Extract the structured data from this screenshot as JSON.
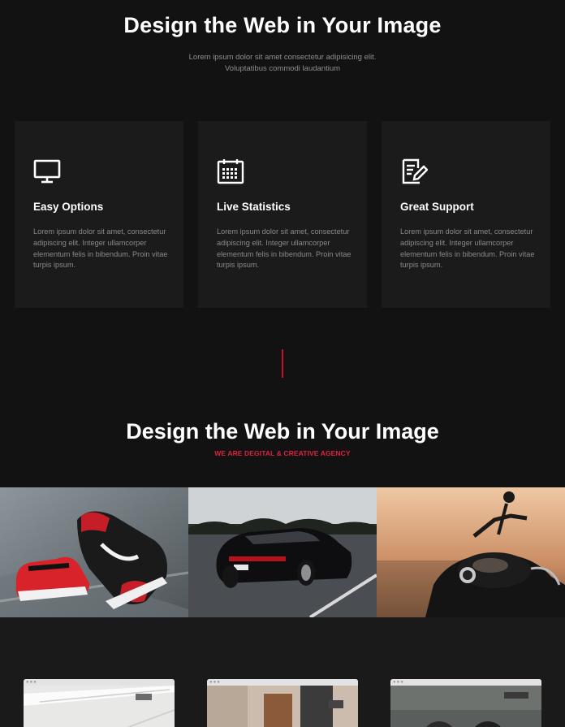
{
  "hero": {
    "title": "Design the Web in Your Image",
    "subtitle_line1": "Lorem ipsum dolor sit amet consectetur adipisicing elit.",
    "subtitle_line2": "Voluptatibus commodi laudantium"
  },
  "features": [
    {
      "icon": "monitor-icon",
      "title": "Easy Options",
      "text": "Lorem ipsum dolor sit amet, consectetur adipiscing elit. Integer ullamcorper elementum felis in bibendum. Proin vitae turpis ipsum."
    },
    {
      "icon": "calendar-icon",
      "title": "Live Statistics",
      "text": "Lorem ipsum dolor sit amet, consectetur adipiscing elit. Integer ullamcorper elementum felis in bibendum. Proin vitae turpis ipsum."
    },
    {
      "icon": "edit-document-icon",
      "title": "Great Support",
      "text": "Lorem ipsum dolor sit amet, consectetur adipiscing elit. Integer ullamcorper elementum felis in bibendum. Proin vitae turpis ipsum."
    }
  ],
  "section2": {
    "title": "Design the Web in Your Image",
    "tagline": "WE ARE DEGITAL & CREATIVE AGENCY"
  },
  "gallery": [
    {
      "name": "sneakers-photo"
    },
    {
      "name": "car-photo"
    },
    {
      "name": "motorcycle-photo"
    }
  ],
  "colors": {
    "background": "#121212",
    "card": "#1b1b1b",
    "accent": "#e0213f"
  }
}
